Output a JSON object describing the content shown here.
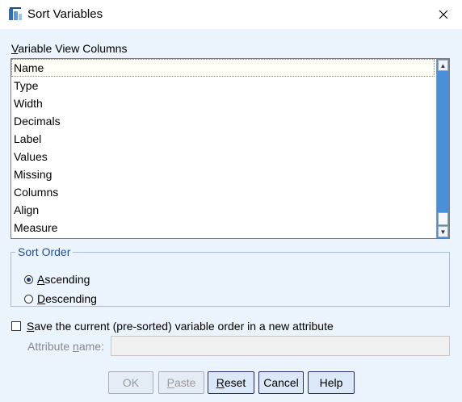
{
  "window": {
    "title": "Sort Variables"
  },
  "columns_label_prefix": "V",
  "columns_label_rest": "ariable View Columns",
  "list": {
    "items": [
      "Name",
      "Type",
      "Width",
      "Decimals",
      "Label",
      "Values",
      "Missing",
      "Columns",
      "Align",
      "Measure"
    ],
    "selected_index": 0
  },
  "sort_order": {
    "legend": "Sort Order",
    "ascending_accel": "A",
    "ascending_rest": "scending",
    "descending_accel": "D",
    "descending_rest": "escending",
    "selected": "ascending"
  },
  "save_attr": {
    "accel": "S",
    "rest": "ave the current (pre-sorted) variable order in a new attribute",
    "checked": false
  },
  "attribute_name": {
    "label_prefix": "Attribute ",
    "label_accel": "n",
    "label_rest": "ame:",
    "value": ""
  },
  "buttons": {
    "ok": "OK",
    "paste_accel": "P",
    "paste_rest": "aste",
    "reset_accel": "R",
    "reset_rest": "eset",
    "cancel": "Cancel",
    "help": "Help"
  },
  "colors": {
    "dialog_bg": "#ebf3fc",
    "scrollbar": "#4a90d9",
    "legend_text": "#1f4e99",
    "button_bg": "#dbe8f8"
  }
}
